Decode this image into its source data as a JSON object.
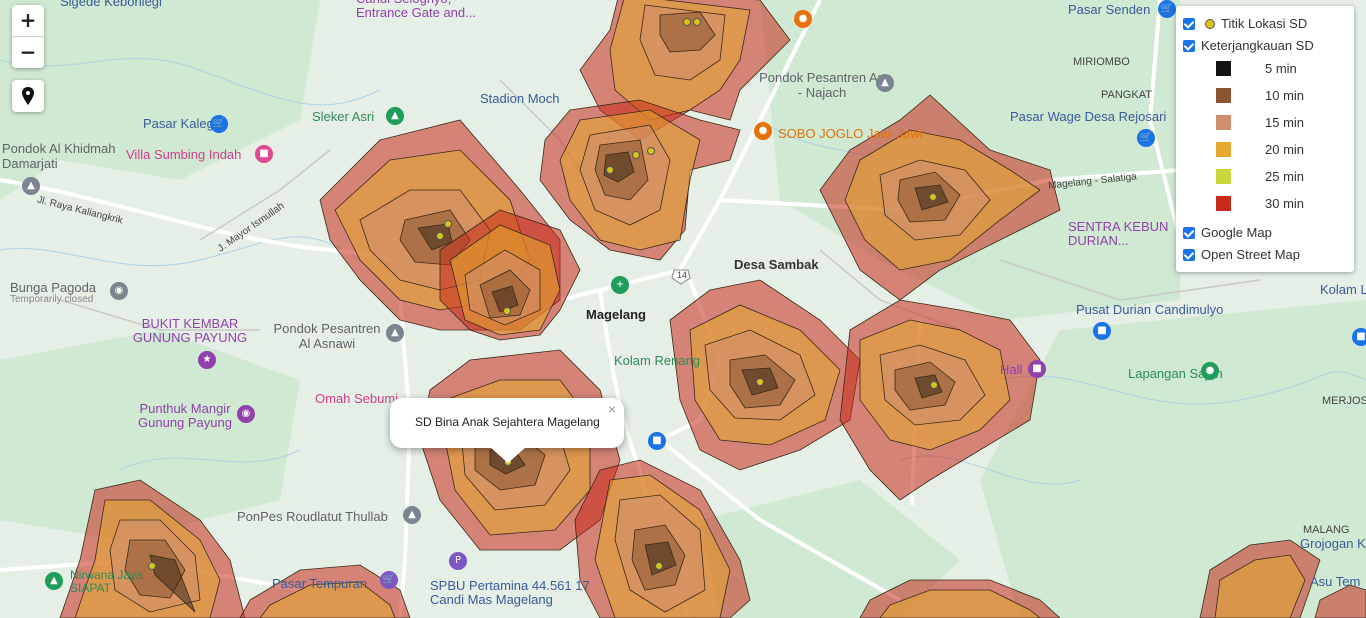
{
  "zoom": {
    "in_label": "+",
    "out_label": "−"
  },
  "legend": {
    "points_label": "Titik Lokasi SD",
    "coverage_label": "Keterjangkauan SD",
    "items": [
      {
        "label": "5 min",
        "color": "#141414"
      },
      {
        "label": "10 min",
        "color": "#8b5532"
      },
      {
        "label": "15 min",
        "color": "#cf9070"
      },
      {
        "label": "20 min",
        "color": "#e6a82e"
      },
      {
        "label": "25 min",
        "color": "#c8d83c"
      },
      {
        "label": "30 min",
        "color": "#c62a1a"
      }
    ],
    "google_label": "Google Map",
    "osm_label": "Open Street Map"
  },
  "popup": {
    "text": "SD Bina Anak Sejahtera Magelang",
    "close": "×"
  },
  "map_labels": [
    {
      "text": "Sigede Kebonlegi",
      "color": "#3a5b9a"
    },
    {
      "text": "Candi Selogriyo, Entrance Gate and...",
      "color": "#9141ac"
    },
    {
      "text": "Pasar Senden",
      "color": "#3a5b9a"
    },
    {
      "text": "Stadion Moch",
      "color": "#3a5b9a"
    },
    {
      "text": "Pondok Pesantren An - Najach",
      "color": "#5f6368"
    },
    {
      "text": "MIRIOMBO",
      "color": "#444"
    },
    {
      "text": "PANGKAT",
      "color": "#444"
    },
    {
      "text": "Sleker Asri",
      "color": "#2e8b57"
    },
    {
      "text": "Pasar Kalegen",
      "color": "#3a5b9a"
    },
    {
      "text": "Pasar Wage Desa Rejosari",
      "color": "#3a5b9a"
    },
    {
      "text": "SOBO JOGLO Jawi Jawi",
      "color": "#e8710a"
    },
    {
      "text": "Pondok Al Khidmah Damarjati",
      "color": "#5f6368"
    },
    {
      "text": "Villa Sumbing Indah",
      "color": "#d23c8c"
    },
    {
      "text": "Magelang - Salatiga",
      "color": "#444"
    },
    {
      "text": "Jl. Raya Kaliangkrik",
      "color": "#444"
    },
    {
      "text": "J. Mayor Ismullah",
      "color": "#444"
    },
    {
      "text": "SENTRA KEBUN DURIAN...",
      "color": "#9141ac"
    },
    {
      "text": "Desa Sambak",
      "color": "#333"
    },
    {
      "text": "Bunga Pagoda",
      "color": "#5f6368"
    },
    {
      "text": "Temporarily closed",
      "color": "#888"
    },
    {
      "text": "Magelang",
      "color": "#222"
    },
    {
      "text": "BUKIT KEMBAR GUNUNG PAYUNG",
      "color": "#9141ac"
    },
    {
      "text": "Pondok Pesantren Al Asnawi",
      "color": "#5f6368"
    },
    {
      "text": "Pusat Durian Candimulyo",
      "color": "#3a5b9a"
    },
    {
      "text": "Kolam Renang",
      "color": "#2e8b57"
    },
    {
      "text": "Lapangan Sajen",
      "color": "#2e8b57"
    },
    {
      "text": "Omah Sebumi",
      "color": "#d23c8c"
    },
    {
      "text": "Punthuk Mangir Gunung Payung",
      "color": "#9141ac"
    },
    {
      "text": "MERJOS",
      "color": "#444"
    },
    {
      "text": "PonPes Roudlatut Thullab",
      "color": "#5f6368"
    },
    {
      "text": "Pasar Tempuran",
      "color": "#3a5b9a"
    },
    {
      "text": "SPBU Pertamina 44.561 17 Candi Mas Magelang",
      "color": "#3a5b9a"
    },
    {
      "text": "MALANG",
      "color": "#444"
    },
    {
      "text": "Grojogan K",
      "color": "#3a5b9a"
    },
    {
      "text": "Asu Tem",
      "color": "#3a5b9a"
    },
    {
      "text": "Nirwana Jaya SIAPAT",
      "color": "#2e8b57"
    },
    {
      "text": "Kolam Lo",
      "color": "#3a5b9a"
    },
    {
      "text": "Hall",
      "color": "#9141ac"
    },
    {
      "text": "14",
      "color": "#444"
    }
  ],
  "road_color": "#ffffff",
  "green_color": "#cde8cf",
  "water_color": "#a9d1f0"
}
